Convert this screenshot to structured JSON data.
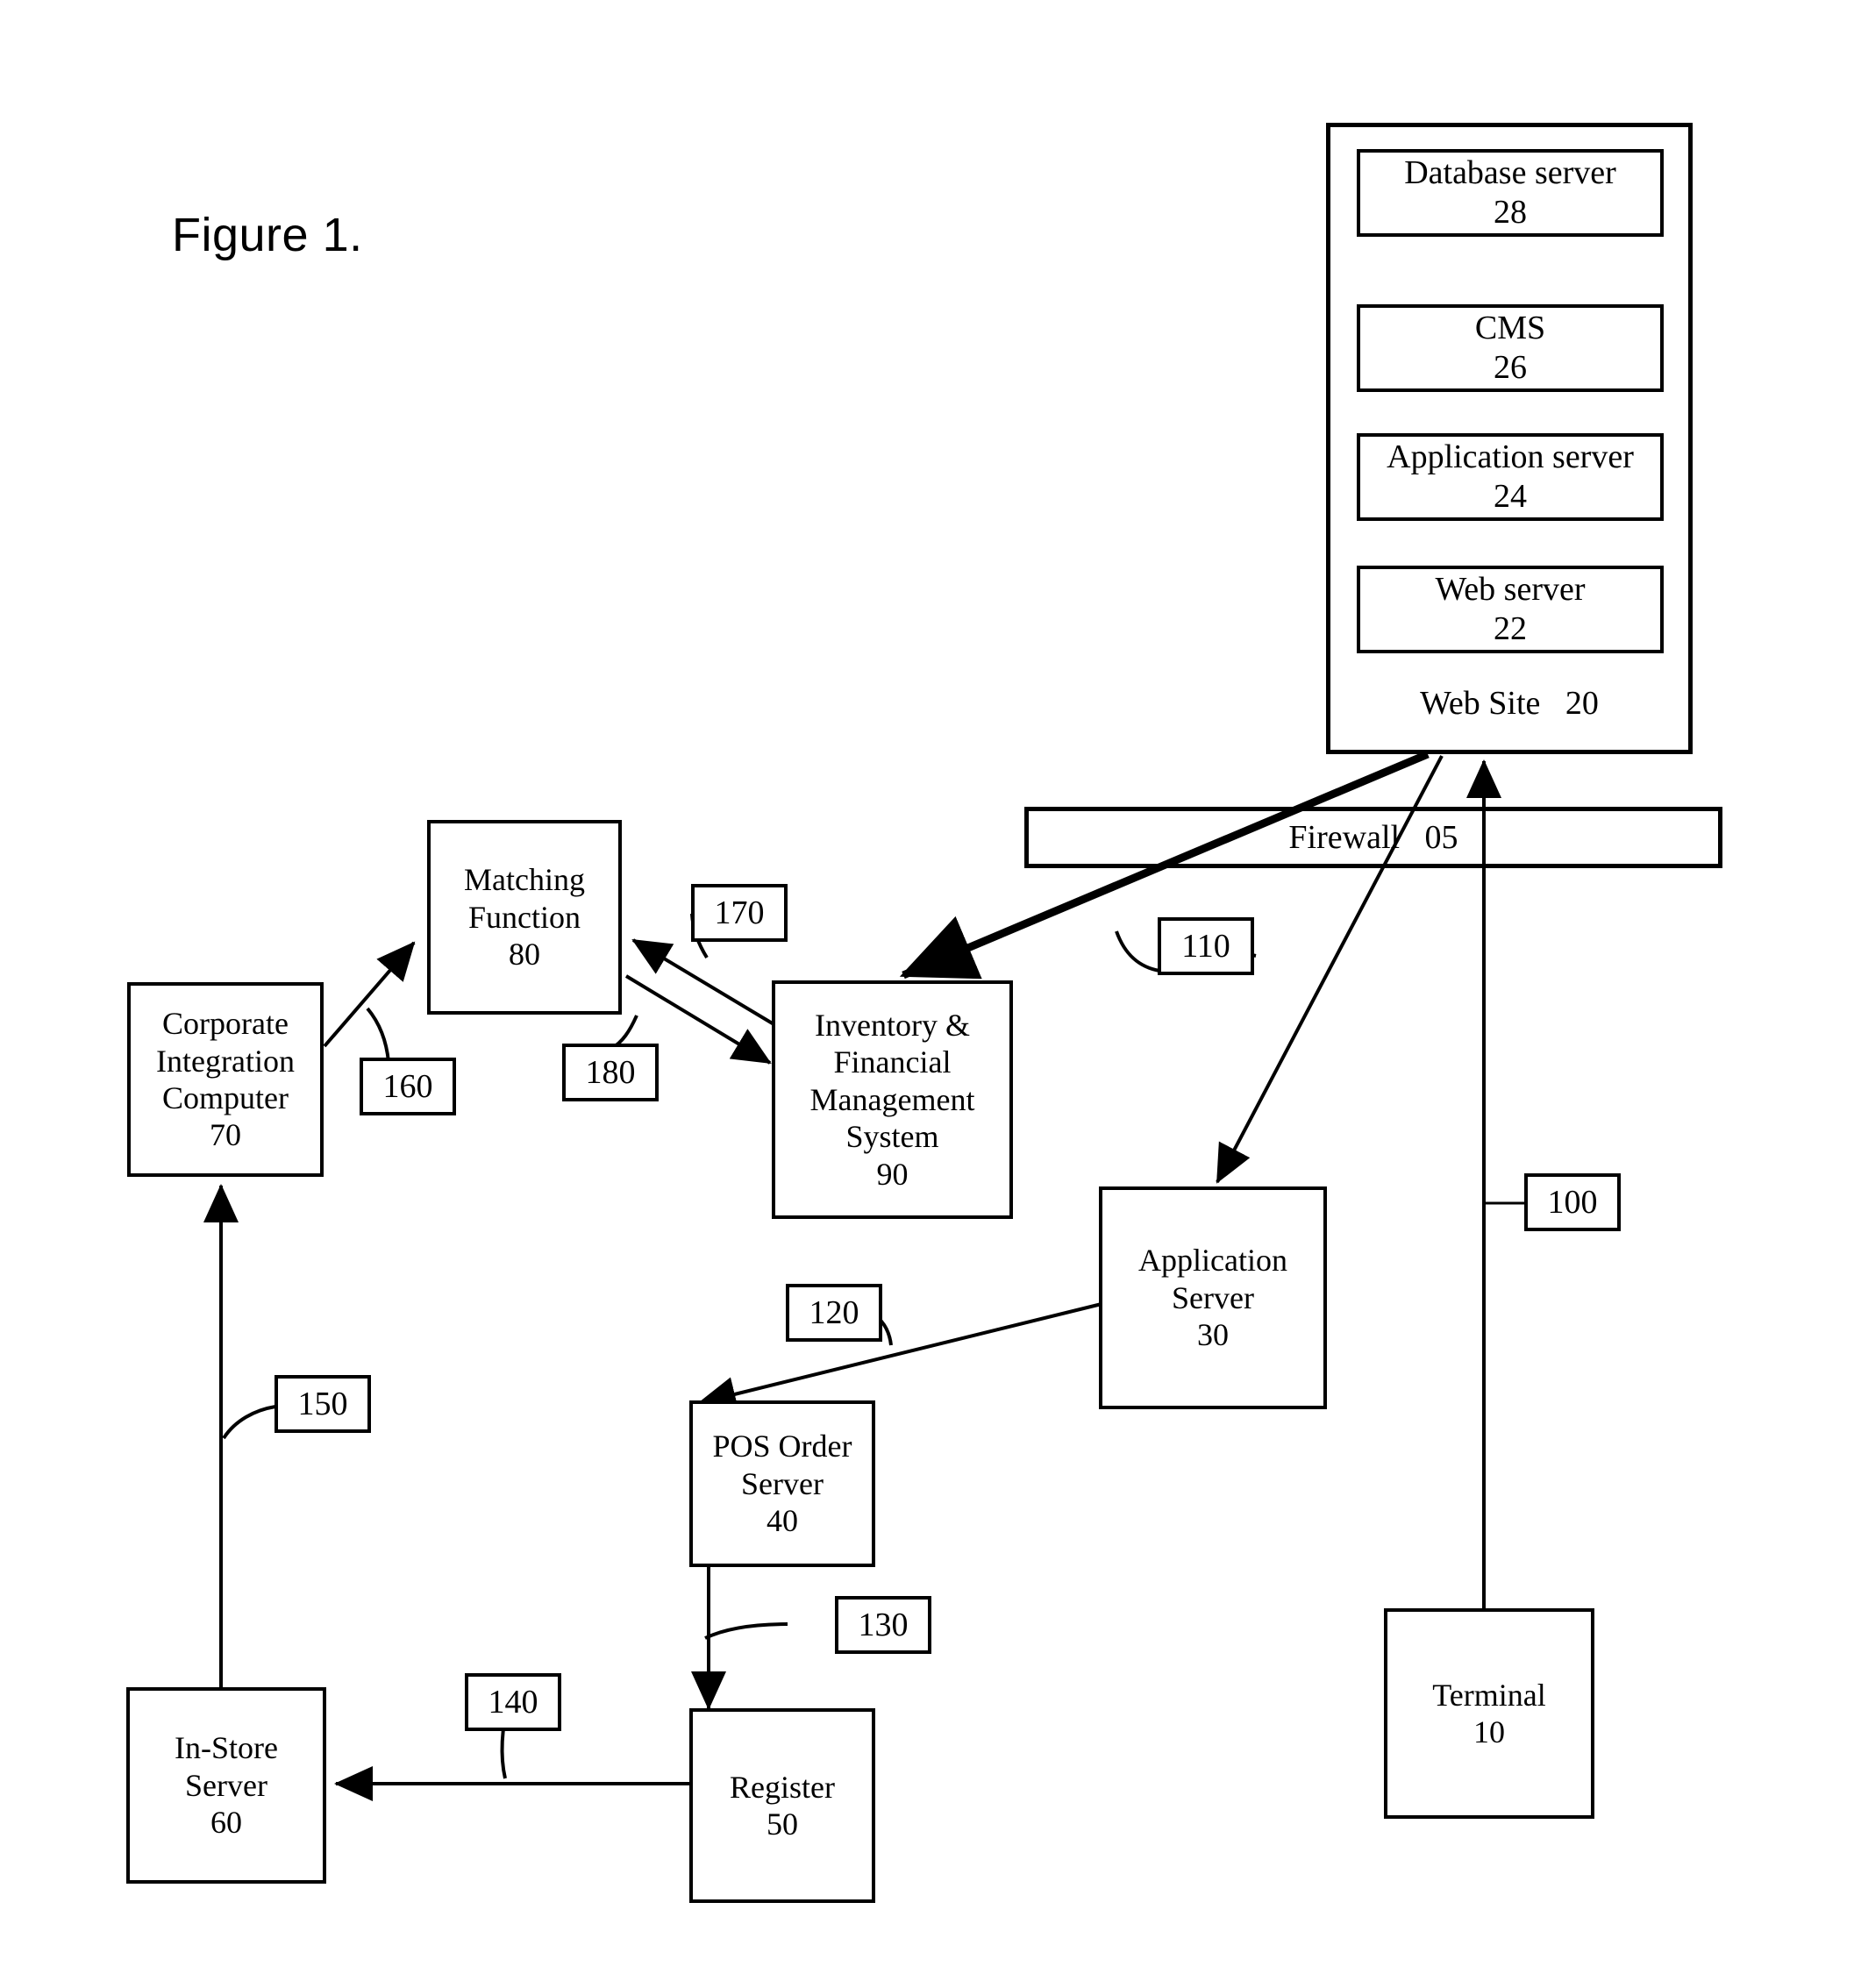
{
  "figure": {
    "caption": "Figure 1."
  },
  "website": {
    "caption": "Web Site   20",
    "servers": [
      {
        "label": "Database server",
        "num": "28"
      },
      {
        "label": "CMS",
        "num": "26"
      },
      {
        "label": "Application server",
        "num": "24"
      },
      {
        "label": "Web server",
        "num": "22"
      }
    ]
  },
  "firewall": {
    "label": "Firewall   05"
  },
  "nodes": [
    {
      "id": "matching-function",
      "label": "Matching\nFunction",
      "num": "80"
    },
    {
      "id": "corporate-integration-computer",
      "label": "Corporate\nIntegration\nComputer",
      "num": "70"
    },
    {
      "id": "inventory-financial-management-system",
      "label": "Inventory &\nFinancial\nManagement\nSystem",
      "num": "90"
    },
    {
      "id": "application-server-30",
      "label": "Application\nServer",
      "num": "30"
    },
    {
      "id": "pos-order-server",
      "label": "POS Order\nServer",
      "num": "40"
    },
    {
      "id": "register",
      "label": "Register",
      "num": "50"
    },
    {
      "id": "in-store-server",
      "label": "In-Store\nServer",
      "num": "60"
    },
    {
      "id": "terminal",
      "label": "Terminal",
      "num": "10"
    }
  ],
  "refs": [
    {
      "id": "ref-100",
      "num": "100"
    },
    {
      "id": "ref-110",
      "num": "110"
    },
    {
      "id": "ref-120",
      "num": "120"
    },
    {
      "id": "ref-130",
      "num": "130"
    },
    {
      "id": "ref-140",
      "num": "140"
    },
    {
      "id": "ref-150",
      "num": "150"
    },
    {
      "id": "ref-160",
      "num": "160"
    },
    {
      "id": "ref-170",
      "num": "170"
    },
    {
      "id": "ref-180",
      "num": "180"
    }
  ],
  "chart_data": {
    "type": "diagram",
    "title": "Figure 1.",
    "nodes": [
      "Database server 28",
      "CMS 26",
      "Application server 24",
      "Web server 22",
      "Web Site 20",
      "Firewall 05",
      "Matching Function 80",
      "Corporate Integration Computer 70",
      "Inventory & Financial Management System 90",
      "Application Server 30",
      "POS Order Server 40",
      "Register 50",
      "In-Store Server 60",
      "Terminal 10"
    ],
    "edges": [
      {
        "from": "CMS 26",
        "to": "Database server 28",
        "label": ""
      },
      {
        "from": "Database server 28",
        "to": "CMS 26",
        "label": ""
      },
      {
        "from": "Application server 24",
        "to": "CMS 26",
        "label": ""
      },
      {
        "from": "CMS 26",
        "to": "Application server 24",
        "label": ""
      },
      {
        "from": "Web server 22",
        "to": "Application server 24",
        "label": ""
      },
      {
        "from": "Application server 24",
        "to": "Web server 22",
        "label": ""
      },
      {
        "from": "Terminal 10",
        "to": "Web Site 20",
        "label": "100"
      },
      {
        "from": "Web Site 20",
        "to": "Application Server 30",
        "label": "110"
      },
      {
        "from": "Application Server 30",
        "to": "POS Order Server 40",
        "label": "120"
      },
      {
        "from": "POS Order Server 40",
        "to": "Register 50",
        "label": "130"
      },
      {
        "from": "Register 50",
        "to": "In-Store Server 60",
        "label": "140"
      },
      {
        "from": "In-Store Server 60",
        "to": "Corporate Integration Computer 70",
        "label": "150"
      },
      {
        "from": "Corporate Integration Computer 70",
        "to": "Matching Function 80",
        "label": "160"
      },
      {
        "from": "Inventory & Financial Management System 90",
        "to": "Matching Function 80",
        "label": "170"
      },
      {
        "from": "Matching Function 80",
        "to": "Inventory & Financial Management System 90",
        "label": "180"
      },
      {
        "from": "Web Site 20",
        "to": "Inventory & Financial Management System 90",
        "label": ""
      }
    ]
  }
}
